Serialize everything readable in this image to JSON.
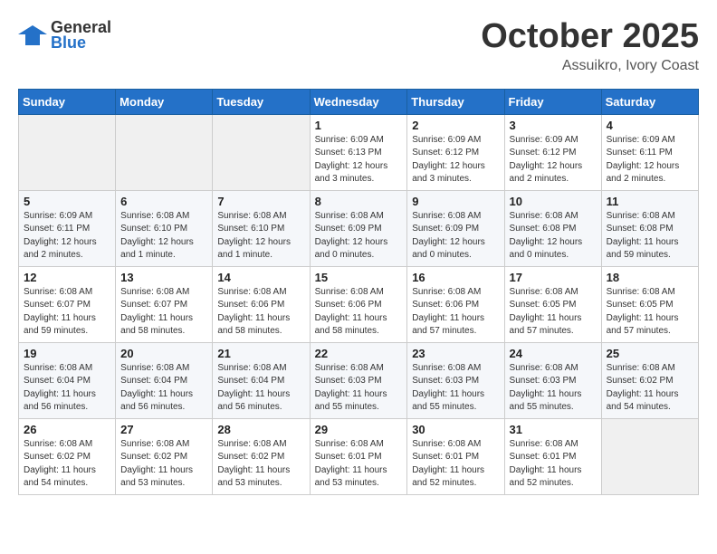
{
  "header": {
    "logo_line1": "General",
    "logo_line2": "Blue",
    "month": "October 2025",
    "location": "Assuikro, Ivory Coast"
  },
  "weekdays": [
    "Sunday",
    "Monday",
    "Tuesday",
    "Wednesday",
    "Thursday",
    "Friday",
    "Saturday"
  ],
  "weeks": [
    [
      {
        "num": "",
        "info": ""
      },
      {
        "num": "",
        "info": ""
      },
      {
        "num": "",
        "info": ""
      },
      {
        "num": "1",
        "info": "Sunrise: 6:09 AM\nSunset: 6:13 PM\nDaylight: 12 hours\nand 3 minutes."
      },
      {
        "num": "2",
        "info": "Sunrise: 6:09 AM\nSunset: 6:12 PM\nDaylight: 12 hours\nand 3 minutes."
      },
      {
        "num": "3",
        "info": "Sunrise: 6:09 AM\nSunset: 6:12 PM\nDaylight: 12 hours\nand 2 minutes."
      },
      {
        "num": "4",
        "info": "Sunrise: 6:09 AM\nSunset: 6:11 PM\nDaylight: 12 hours\nand 2 minutes."
      }
    ],
    [
      {
        "num": "5",
        "info": "Sunrise: 6:09 AM\nSunset: 6:11 PM\nDaylight: 12 hours\nand 2 minutes."
      },
      {
        "num": "6",
        "info": "Sunrise: 6:08 AM\nSunset: 6:10 PM\nDaylight: 12 hours\nand 1 minute."
      },
      {
        "num": "7",
        "info": "Sunrise: 6:08 AM\nSunset: 6:10 PM\nDaylight: 12 hours\nand 1 minute."
      },
      {
        "num": "8",
        "info": "Sunrise: 6:08 AM\nSunset: 6:09 PM\nDaylight: 12 hours\nand 0 minutes."
      },
      {
        "num": "9",
        "info": "Sunrise: 6:08 AM\nSunset: 6:09 PM\nDaylight: 12 hours\nand 0 minutes."
      },
      {
        "num": "10",
        "info": "Sunrise: 6:08 AM\nSunset: 6:08 PM\nDaylight: 12 hours\nand 0 minutes."
      },
      {
        "num": "11",
        "info": "Sunrise: 6:08 AM\nSunset: 6:08 PM\nDaylight: 11 hours\nand 59 minutes."
      }
    ],
    [
      {
        "num": "12",
        "info": "Sunrise: 6:08 AM\nSunset: 6:07 PM\nDaylight: 11 hours\nand 59 minutes."
      },
      {
        "num": "13",
        "info": "Sunrise: 6:08 AM\nSunset: 6:07 PM\nDaylight: 11 hours\nand 58 minutes."
      },
      {
        "num": "14",
        "info": "Sunrise: 6:08 AM\nSunset: 6:06 PM\nDaylight: 11 hours\nand 58 minutes."
      },
      {
        "num": "15",
        "info": "Sunrise: 6:08 AM\nSunset: 6:06 PM\nDaylight: 11 hours\nand 58 minutes."
      },
      {
        "num": "16",
        "info": "Sunrise: 6:08 AM\nSunset: 6:06 PM\nDaylight: 11 hours\nand 57 minutes."
      },
      {
        "num": "17",
        "info": "Sunrise: 6:08 AM\nSunset: 6:05 PM\nDaylight: 11 hours\nand 57 minutes."
      },
      {
        "num": "18",
        "info": "Sunrise: 6:08 AM\nSunset: 6:05 PM\nDaylight: 11 hours\nand 57 minutes."
      }
    ],
    [
      {
        "num": "19",
        "info": "Sunrise: 6:08 AM\nSunset: 6:04 PM\nDaylight: 11 hours\nand 56 minutes."
      },
      {
        "num": "20",
        "info": "Sunrise: 6:08 AM\nSunset: 6:04 PM\nDaylight: 11 hours\nand 56 minutes."
      },
      {
        "num": "21",
        "info": "Sunrise: 6:08 AM\nSunset: 6:04 PM\nDaylight: 11 hours\nand 56 minutes."
      },
      {
        "num": "22",
        "info": "Sunrise: 6:08 AM\nSunset: 6:03 PM\nDaylight: 11 hours\nand 55 minutes."
      },
      {
        "num": "23",
        "info": "Sunrise: 6:08 AM\nSunset: 6:03 PM\nDaylight: 11 hours\nand 55 minutes."
      },
      {
        "num": "24",
        "info": "Sunrise: 6:08 AM\nSunset: 6:03 PM\nDaylight: 11 hours\nand 55 minutes."
      },
      {
        "num": "25",
        "info": "Sunrise: 6:08 AM\nSunset: 6:02 PM\nDaylight: 11 hours\nand 54 minutes."
      }
    ],
    [
      {
        "num": "26",
        "info": "Sunrise: 6:08 AM\nSunset: 6:02 PM\nDaylight: 11 hours\nand 54 minutes."
      },
      {
        "num": "27",
        "info": "Sunrise: 6:08 AM\nSunset: 6:02 PM\nDaylight: 11 hours\nand 53 minutes."
      },
      {
        "num": "28",
        "info": "Sunrise: 6:08 AM\nSunset: 6:02 PM\nDaylight: 11 hours\nand 53 minutes."
      },
      {
        "num": "29",
        "info": "Sunrise: 6:08 AM\nSunset: 6:01 PM\nDaylight: 11 hours\nand 53 minutes."
      },
      {
        "num": "30",
        "info": "Sunrise: 6:08 AM\nSunset: 6:01 PM\nDaylight: 11 hours\nand 52 minutes."
      },
      {
        "num": "31",
        "info": "Sunrise: 6:08 AM\nSunset: 6:01 PM\nDaylight: 11 hours\nand 52 minutes."
      },
      {
        "num": "",
        "info": ""
      }
    ]
  ]
}
